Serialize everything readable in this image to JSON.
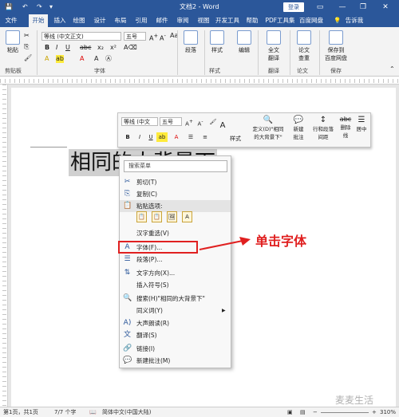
{
  "titlebar": {
    "title": "文档2 - Word",
    "login": "登录"
  },
  "tabs": [
    "文件",
    "开始",
    "插入",
    "绘图",
    "设计",
    "布局",
    "引用",
    "邮件",
    "审阅",
    "视图",
    "开发工具",
    "帮助",
    "PDF工具集",
    "百度网盘",
    "告诉我"
  ],
  "ribbon": {
    "paste": "粘贴",
    "clipboard_label": "剪贴板",
    "font_name": "等线 (中文正文)",
    "font_size": "五号",
    "font_label": "字体",
    "paragraph_btn": "段落",
    "styles_btn": "样式",
    "styles_label": "样式",
    "edit_btn": "编辑",
    "full_translate_line1": "全文",
    "full_translate_line2": "翻译",
    "paper_check_line1": "论文",
    "paper_check_line2": "查重",
    "save_baidu_line1": "保存到",
    "save_baidu_line2": "百度网盘",
    "translate_label": "翻译",
    "paper_label": "论文",
    "save_label": "保存"
  },
  "document": {
    "selected_text": "相同的大背景下"
  },
  "minitoolbar": {
    "font_name": "等线 (中文",
    "font_size": "五号",
    "styles": "样式",
    "define_line1": "定义(D)\"相同",
    "define_line2": "的大背景下\"",
    "new_comment_line1": "新建",
    "new_comment_line2": "批注",
    "line_spacing_line1": "行和段落",
    "line_spacing_line2": "间距",
    "strike_line1": "删除",
    "strike_line2": "线",
    "center": "居中"
  },
  "context_menu": {
    "search_placeholder": "搜索菜单",
    "items": [
      {
        "icon": "scissors",
        "label": "剪切(T)"
      },
      {
        "icon": "copy",
        "label": "复制(C)"
      },
      {
        "icon": "paste",
        "label": "粘贴选项:"
      },
      {
        "icon": "",
        "label": "汉字重选(V)"
      },
      {
        "icon": "font",
        "label": "字体(F)..."
      },
      {
        "icon": "paragraph",
        "label": "段落(P)..."
      },
      {
        "icon": "text-direction",
        "label": "文字方向(X)..."
      },
      {
        "icon": "",
        "label": "插入符号(S)"
      },
      {
        "icon": "search",
        "label": "搜索(H)\"相同的大背景下\""
      },
      {
        "icon": "",
        "label": "同义词(Y)"
      },
      {
        "icon": "read-aloud",
        "label": "大声朗读(R)"
      },
      {
        "icon": "translate",
        "label": "翻译(S)"
      },
      {
        "icon": "link",
        "label": "链接(I)"
      },
      {
        "icon": "new-comment",
        "label": "新建批注(M)"
      }
    ]
  },
  "annotation": "单击字体",
  "statusbar": {
    "page": "第1页，共1页",
    "count": "7/7 个字",
    "language": "简体中文(中国大陆)",
    "zoom": "310%"
  },
  "watermark": "麦麦生活",
  "colors": {
    "title_blue": "#2b579a",
    "annotation_red": "#e02020"
  }
}
